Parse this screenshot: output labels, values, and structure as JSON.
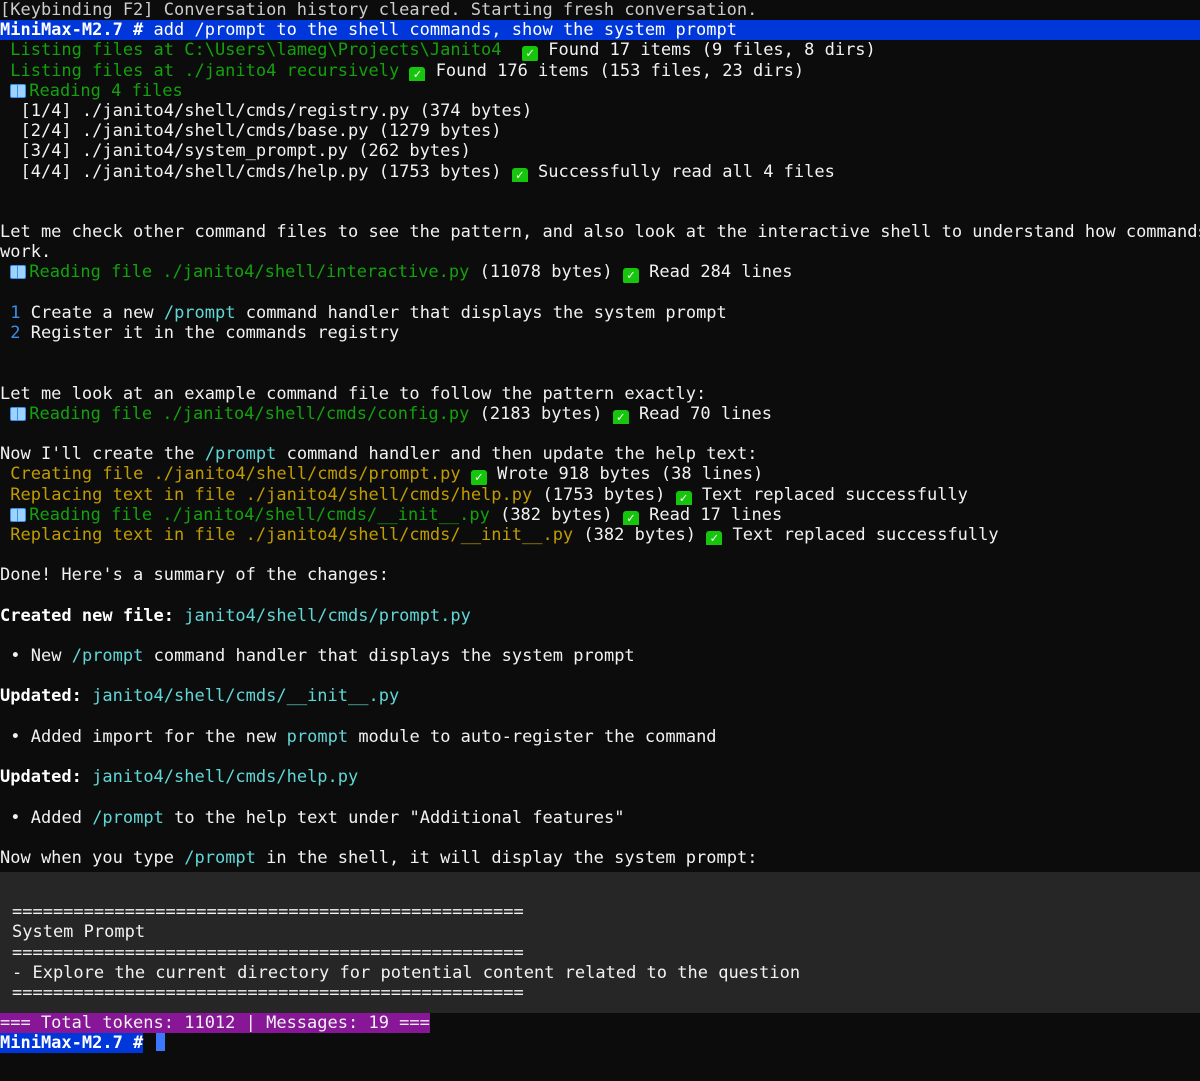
{
  "l01": "[Keybinding F2] Conversation history cleared. Starting fresh conversation.",
  "prompt": "MiniMax-M2.7 #",
  "l02cmd": "add /prompt to the shell commands, show the system prompt",
  "l03a": "Listing files at C:\\Users\\lameg\\Projects\\Janito4",
  "l03b": "Found 17 items (9 files, 8 dirs)",
  "l04a": "Listing files at ./janito4 recursively",
  "l04b": "Found 176 items (153 files, 23 dirs)",
  "l05": "Reading 4 files",
  "l06": "[1/4] ./janito4/shell/cmds/registry.py (374 bytes)",
  "l07": "[2/4] ./janito4/shell/cmds/base.py (1279 bytes)",
  "l08": "[3/4] ./janito4/system_prompt.py (262 bytes)",
  "l09a": "[4/4] ./janito4/shell/cmds/help.py (1753 bytes)",
  "l09b": "Successfully read all 4 files",
  "l12": "Let me check other command files to see the pattern, and also look at the interactive shell to understand how commands",
  "l13": "work.",
  "l14a": "Reading file ./janito4/shell/interactive.py",
  "l14b": "(11078 bytes)",
  "l14c": "Read 284 lines",
  "l16n": "1",
  "l16a": "Create a new",
  "l16c": "/prompt",
  "l16b": "command handler that displays the system prompt",
  "l17n": "2",
  "l17a": "Register it in the commands registry",
  "l20": "Let me look at an example command file to follow the pattern exactly:",
  "l21a": "Reading file ./janito4/shell/cmds/config.py",
  "l21b": "(2183 bytes)",
  "l21c": "Read 70 lines",
  "l23a": "Now I'll create the",
  "l23c": "/prompt",
  "l23b": "command handler and then update the help text:",
  "l24a": "Creating file ./janito4/shell/cmds/prompt.py",
  "l24b": "Wrote 918 bytes (38 lines)",
  "l25a": "Replacing text in file ./janito4/shell/cmds/help.py",
  "l25b": "(1753 bytes)",
  "l25c": "Text replaced successfully",
  "l26a": "Reading file ./janito4/shell/cmds/__init__.py",
  "l26b": "(382 bytes)",
  "l26c": "Read 17 lines",
  "l27a": "Replacing text in file ./janito4/shell/cmds/__init__.py",
  "l27b": "(382 bytes)",
  "l27c": "Text replaced successfully",
  "l29": "Done! Here's a summary of the changes:",
  "l31a": "Created new file:",
  "l31c": "janito4/shell/cmds/prompt.py",
  "l33a": "New",
  "l33c": "/prompt",
  "l33b": "command handler that displays the system prompt",
  "l35a": "Updated:",
  "l35c": "janito4/shell/cmds/__init__.py",
  "l37a": "Added import for the new",
  "l37c": "prompt",
  "l37b": "module to auto-register the command",
  "l39a": "Updated:",
  "l39c": "janito4/shell/cmds/help.py",
  "l41a": "Added",
  "l41c": "/prompt",
  "l41b": "to the help text under \"Additional features\"",
  "l43a": "Now when you type",
  "l43c": "/prompt",
  "l43b": "in the shell, it will display the system prompt:",
  "code": {
    "sep": "==================================================",
    "title": "System Prompt",
    "body": "- Explore the current directory for potential content related to the question"
  },
  "status": "=== Total tokens: 11012 | Messages: 19 ===",
  "bullet": "•",
  "check_glyph": "✓",
  "icons": {
    "check": "check-mark-icon",
    "book": "book-icon",
    "cursor": "text-cursor"
  },
  "colors": {
    "green": "#13a10e",
    "yellow": "#c19c00",
    "cyan": "#61d6d6",
    "prompt_bg": "#0037da",
    "status_bg": "#881798",
    "check_bg": "#16c60c"
  }
}
